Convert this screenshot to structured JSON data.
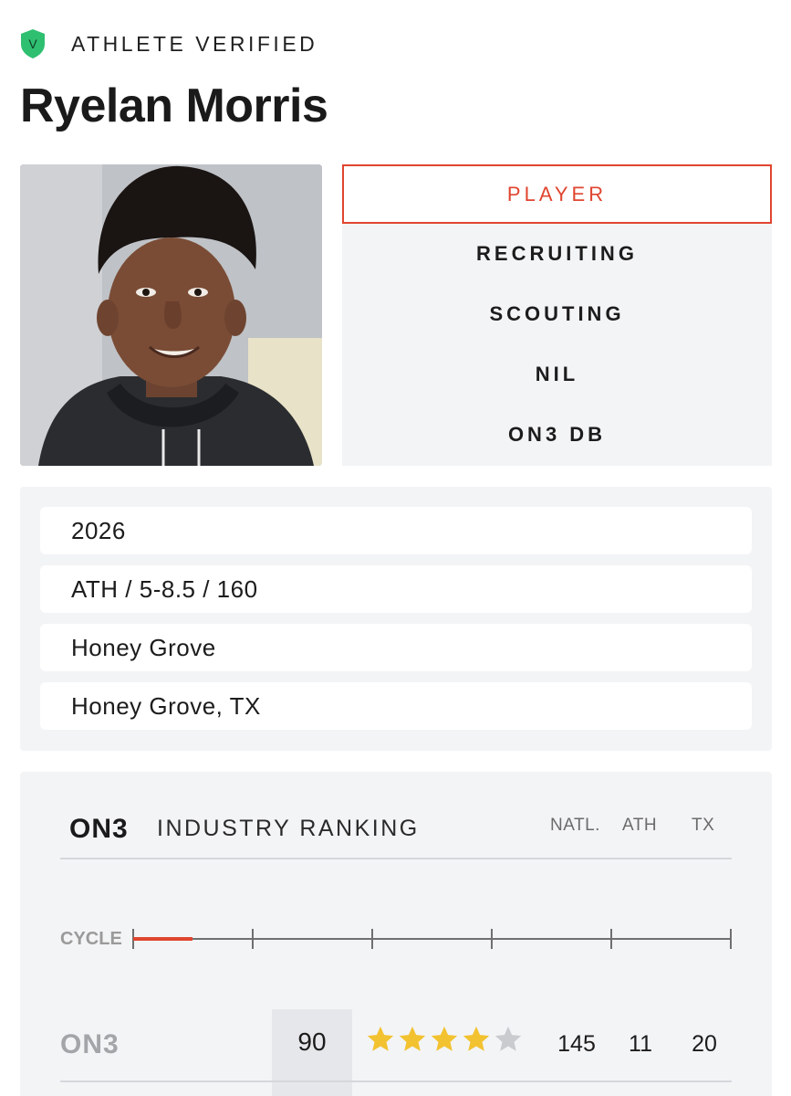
{
  "header": {
    "verified_badge_letter": "V",
    "verified_label": "ATHLETE VERIFIED",
    "player_name": "Ryelan Morris"
  },
  "nav": {
    "items": [
      {
        "label": "PLAYER",
        "active": true
      },
      {
        "label": "RECRUITING",
        "active": false
      },
      {
        "label": "SCOUTING",
        "active": false
      },
      {
        "label": "NIL",
        "active": false
      },
      {
        "label": "ON3 DB",
        "active": false
      }
    ]
  },
  "info": {
    "class_year": "2026",
    "position_size": "ATH / 5-8.5 / 160",
    "high_school": "Honey Grove",
    "hometown": "Honey Grove, TX"
  },
  "ranking": {
    "logo_text": "ON3",
    "title": "INDUSTRY RANKING",
    "columns": [
      "NATL.",
      "ATH",
      "TX"
    ],
    "cycle_label": "CYCLE",
    "row": {
      "source": "ON3",
      "score": "90",
      "stars": 4,
      "stars_max": 5,
      "natl": "145",
      "ath": "11",
      "tx": "20"
    }
  },
  "colors": {
    "accent": "#e0452f",
    "verified_green": "#2fbf71",
    "star_gold": "#f2c230",
    "star_empty": "#c9cbcf",
    "panel_bg": "#f3f4f6"
  }
}
